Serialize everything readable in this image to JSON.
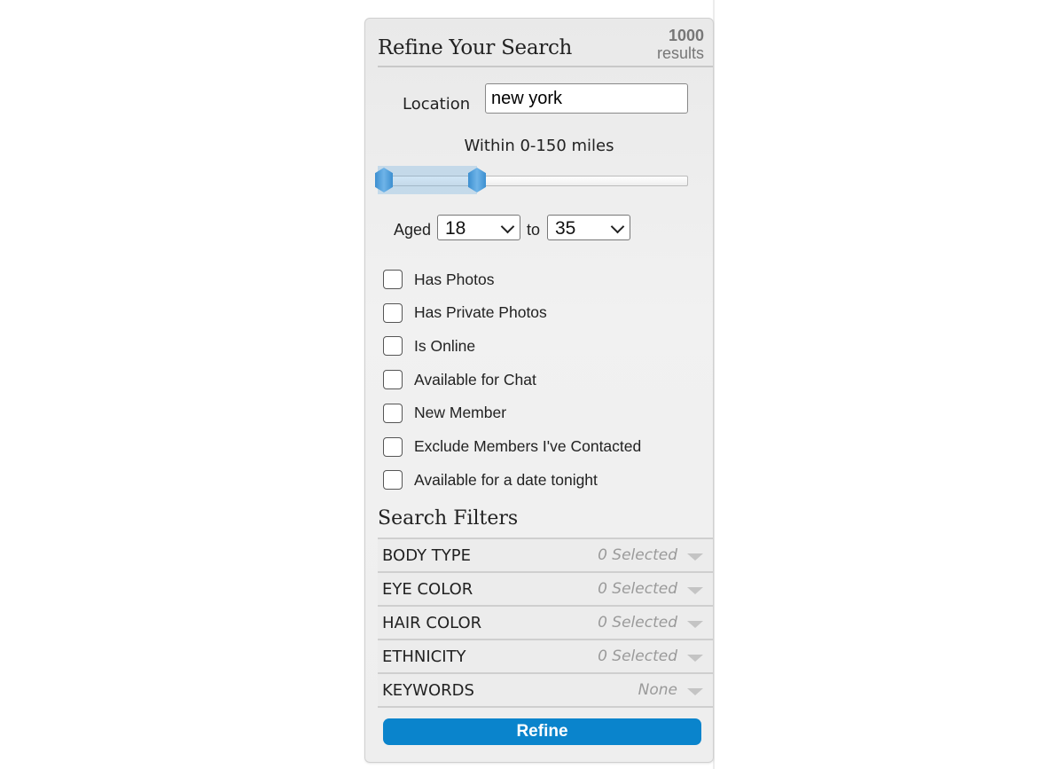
{
  "header": {
    "title": "Refine Your Search",
    "result_count": "1000",
    "result_unit": "results"
  },
  "location": {
    "label": "Location",
    "value": "new york"
  },
  "distance": {
    "label": "Within 0-150 miles",
    "range_low": 0,
    "range_high": 150,
    "unit": "miles"
  },
  "age": {
    "label": "Aged",
    "from": "18",
    "separator": "to",
    "to": "35"
  },
  "checkboxes": [
    {
      "label": "Has Photos",
      "checked": false
    },
    {
      "label": "Has Private Photos",
      "checked": false
    },
    {
      "label": "Is Online",
      "checked": false
    },
    {
      "label": "Available for Chat",
      "checked": false
    },
    {
      "label": "New Member",
      "checked": false
    },
    {
      "label": "Exclude Members I've Contacted",
      "checked": false
    },
    {
      "label": "Available for a date tonight",
      "checked": false
    }
  ],
  "search_filters": {
    "title": "Search Filters",
    "items": [
      {
        "name": "BODY TYPE",
        "value": "0 Selected"
      },
      {
        "name": "EYE COLOR",
        "value": "0 Selected"
      },
      {
        "name": "HAIR COLOR",
        "value": "0 Selected"
      },
      {
        "name": "ETHNICITY",
        "value": "0 Selected"
      },
      {
        "name": "KEYWORDS",
        "value": "None"
      }
    ]
  },
  "refine_button": {
    "label": "Refine"
  },
  "colors": {
    "accent": "#0a84cc",
    "slider": "#3c8fd0"
  }
}
